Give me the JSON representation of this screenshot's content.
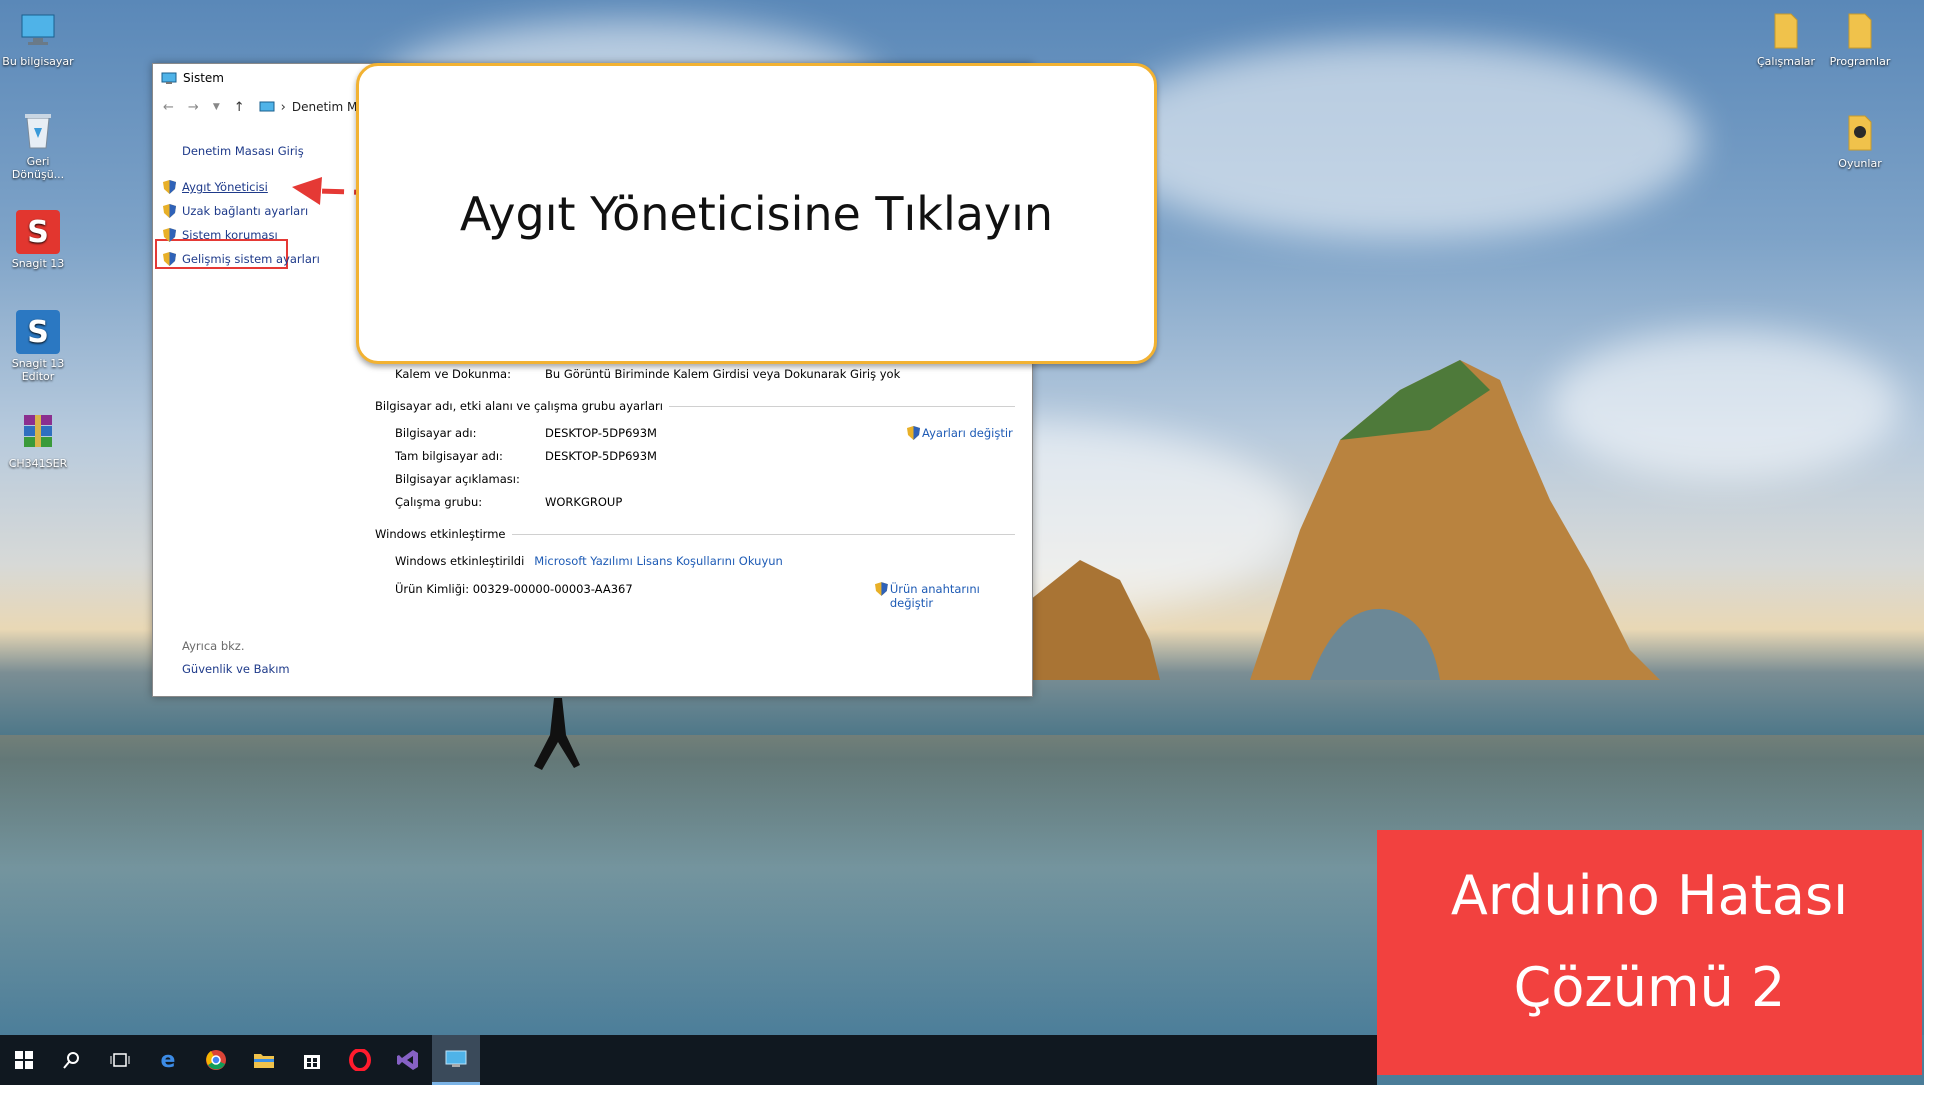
{
  "desktop_icons_left": [
    {
      "label": "Bu bilgisayar",
      "icon": "computer-icon"
    },
    {
      "label": "Geri Dönüşü...",
      "icon": "recycle-bin-icon"
    },
    {
      "label": "Snagit 13",
      "icon": "snagit-icon"
    },
    {
      "label": "Snagit 13 Editor",
      "icon": "snagit-editor-icon"
    },
    {
      "label": "CH341SER",
      "icon": "winrar-archive-icon"
    }
  ],
  "desktop_icons_right": [
    {
      "label": "Çalışmalar",
      "icon": "folder-icon"
    },
    {
      "label": "Programlar",
      "icon": "folder-icon"
    },
    {
      "label": "Oyunlar",
      "icon": "games-folder-icon"
    }
  ],
  "window": {
    "title": "Sistem",
    "address": "Denetim M",
    "sidebar": {
      "home": "Denetim Masası Giriş",
      "links": [
        "Aygıt Yöneticisi",
        "Uzak bağlantı ayarları",
        "Sistem koruması",
        "Gelişmiş sistem ayarları"
      ],
      "see_also": "Ayrıca bkz.",
      "see_also_link": "Güvenlik ve Bakım"
    },
    "pen_label": "Kalem ve Dokunma:",
    "pen_value": "Bu Görüntü Biriminde Kalem Girdisi veya Dokunarak Giriş yok",
    "computer_section": "Bilgisayar adı, etki alanı ve çalışma grubu ayarları",
    "computer_rows": [
      {
        "label": "Bilgisayar adı:",
        "value": "DESKTOP-5DP693M"
      },
      {
        "label": "Tam bilgisayar adı:",
        "value": "DESKTOP-5DP693M"
      },
      {
        "label": "Bilgisayar açıklaması:",
        "value": ""
      },
      {
        "label": "Çalışma grubu:",
        "value": "WORKGROUP"
      }
    ],
    "change_settings": "Ayarları değiştir",
    "activation_section": "Windows etkinleştirme",
    "activated_label": "Windows etkinleştirildi",
    "license_link": "Microsoft Yazılımı Lisans Koşullarını Okuyun",
    "product_id": "Ürün Kimliği:  00329-00000-00003-AA367",
    "change_key": "Ürün anahtarını değiştir"
  },
  "callout": {
    "text": "Aygıt Yöneticisine Tıklayın"
  },
  "banner": {
    "line1": "Arduino Hatası",
    "line2": "Çözümü 2"
  },
  "taskbar": {
    "items": [
      "start-icon",
      "search-icon",
      "task-view-icon",
      "edge-icon",
      "chrome-icon",
      "file-explorer-icon",
      "store-icon",
      "opera-icon",
      "visual-studio-icon",
      "system-window-icon"
    ],
    "active_index": 9
  },
  "colors": {
    "callout_border": "#f2b232",
    "banner": "#f2413f",
    "highlight": "#e53935",
    "link": "#1e3a8a"
  }
}
